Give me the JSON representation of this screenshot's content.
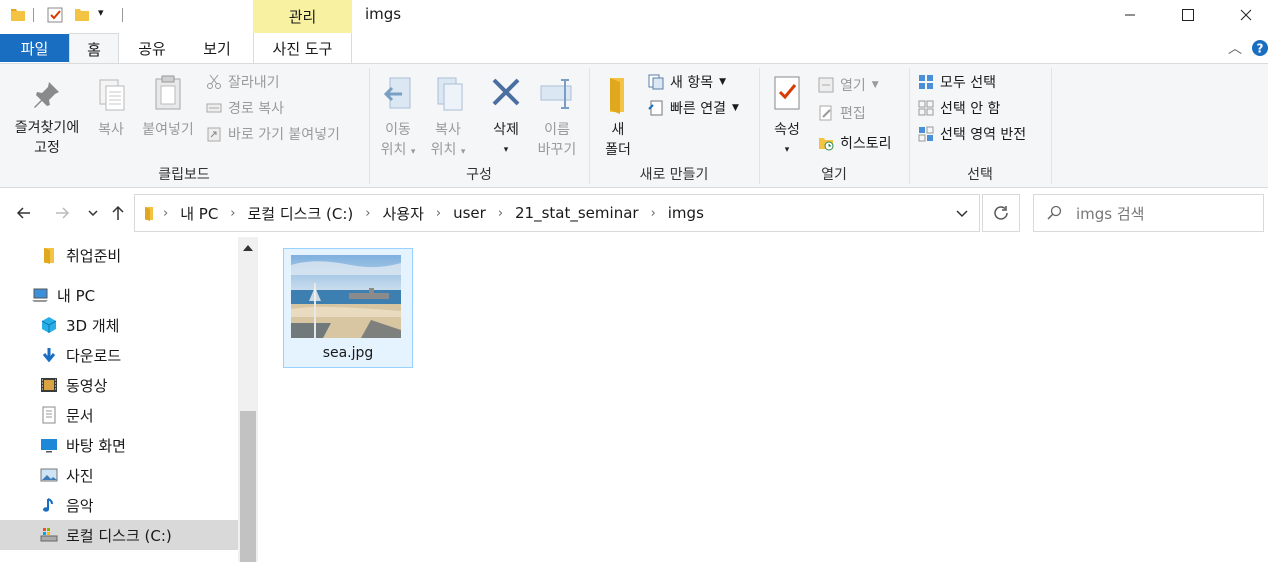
{
  "titlebar": {
    "context_tab": "관리",
    "title": "imgs"
  },
  "tabs": {
    "file": "파일",
    "home": "홈",
    "share": "공유",
    "view": "보기",
    "photo_tools": "사진 도구"
  },
  "ribbon": {
    "clipboard": {
      "pin": "즐겨찾기에\n고정",
      "pin_line1": "즐겨찾기에",
      "pin_line2": "고정",
      "copy": "복사",
      "paste": "붙여넣기",
      "cut": "잘라내기",
      "copy_path": "경로 복사",
      "paste_shortcut": "바로 가기 붙여넣기",
      "group_label": "클립보드"
    },
    "organize": {
      "move_line1": "이동",
      "move_line2": "위치",
      "copyto_line1": "복사",
      "copyto_line2": "위치",
      "delete": "삭제",
      "rename_line1": "이름",
      "rename_line2": "바꾸기",
      "group_label": "구성"
    },
    "new": {
      "folder_line1": "새",
      "folder_line2": "폴더",
      "new_item": "새 항목",
      "easy_access": "빠른 연결",
      "group_label": "새로 만들기"
    },
    "open": {
      "properties": "속성",
      "open": "열기",
      "edit": "편집",
      "history": "히스토리",
      "group_label": "열기"
    },
    "select": {
      "select_all": "모두 선택",
      "select_none": "선택 안 함",
      "invert": "선택 영역 반전",
      "group_label": "선택"
    }
  },
  "address": {
    "crumbs": [
      "내 PC",
      "로컬 디스크 (C:)",
      "사용자",
      "user",
      "21_stat_seminar",
      "imgs"
    ],
    "search_placeholder": "imgs 검색"
  },
  "nav": {
    "items": [
      {
        "label": "취업준비",
        "icon": "folder-icon"
      },
      {
        "label": "내 PC",
        "icon": "pc-icon"
      },
      {
        "label": "3D 개체",
        "icon": "3d-objects-icon"
      },
      {
        "label": "다운로드",
        "icon": "download-icon"
      },
      {
        "label": "동영상",
        "icon": "video-icon"
      },
      {
        "label": "문서",
        "icon": "document-icon"
      },
      {
        "label": "바탕 화면",
        "icon": "desktop-icon"
      },
      {
        "label": "사진",
        "icon": "pictures-icon"
      },
      {
        "label": "음악",
        "icon": "music-icon"
      },
      {
        "label": "로컬 디스크 (C:)",
        "icon": "drive-icon"
      }
    ]
  },
  "files": [
    {
      "name": "sea.jpg"
    }
  ],
  "colors": {
    "file_tab": "#1a6ec1",
    "context_tab": "#f8f1a1",
    "selection": "#e5f3ff",
    "selection_border": "#99d1ff"
  }
}
